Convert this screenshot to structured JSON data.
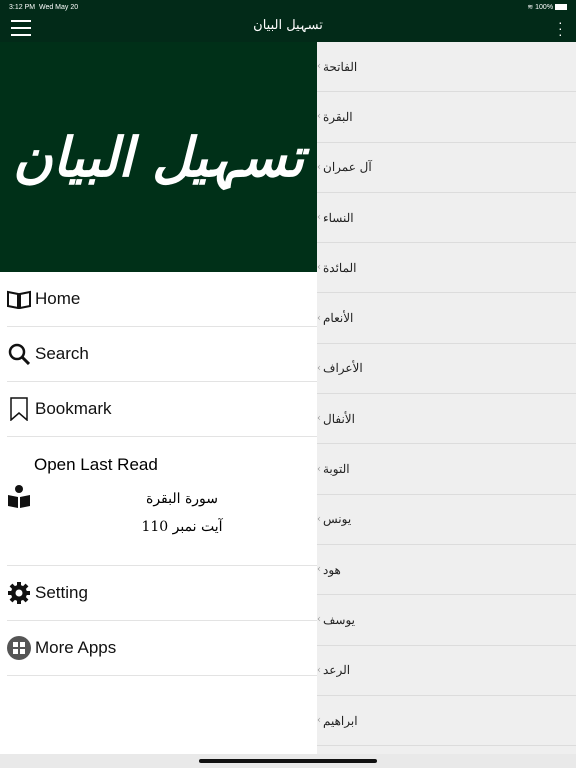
{
  "status": {
    "time": "3:12 PM",
    "date": "Wed May 20",
    "battery": "100%"
  },
  "nav": {
    "title": "تسہیل البیان"
  },
  "drawer": {
    "banner": "تسہیل البیان",
    "items": [
      {
        "label": "Home",
        "icon": "book-open-icon"
      },
      {
        "label": "Search",
        "icon": "search-icon"
      },
      {
        "label": "Bookmark",
        "icon": "bookmark-icon"
      }
    ],
    "last_read": {
      "label": "Open Last Read",
      "surah": "سورة البقرة",
      "ayah": "آیت نمبر 110"
    },
    "items2": [
      {
        "label": "Setting",
        "icon": "gear-icon"
      },
      {
        "label": "More Apps",
        "icon": "apps-icon"
      }
    ]
  },
  "surahs": [
    "الفاتحة",
    "البقرة",
    "آل عمران",
    "النساء",
    "المائدة",
    "الأنعام",
    "الأعراف",
    "الأنفال",
    "التوبة",
    "يونس",
    "هود",
    "يوسف",
    "الرعد",
    "ابراهيم"
  ],
  "colors": {
    "primary": "#022a18",
    "banner": "#003018"
  }
}
